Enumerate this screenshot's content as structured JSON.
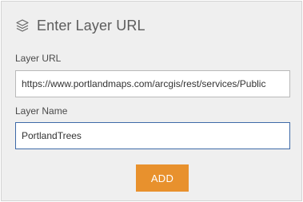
{
  "header": {
    "icon": "layers-icon",
    "title": "Enter Layer URL"
  },
  "layer_url": {
    "label": "Layer URL",
    "value": "https://www.portlandmaps.com/arcgis/rest/services/Public"
  },
  "layer_name": {
    "label": "Layer Name",
    "value": "PortlandTrees"
  },
  "actions": {
    "add_label": "ADD"
  },
  "colors": {
    "accent_button": "#e8912d",
    "focus_border": "#3e6aa8",
    "panel_background": "#efefef"
  }
}
